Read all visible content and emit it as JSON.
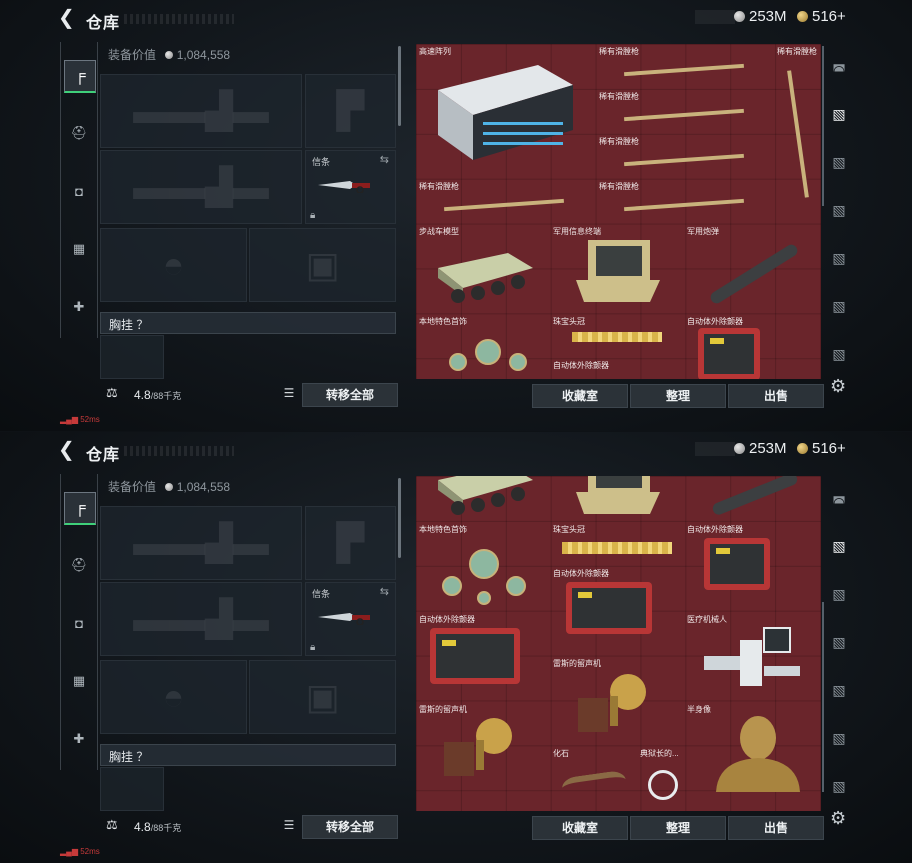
{
  "header": {
    "title": "仓库",
    "currency_1": "253M",
    "currency_2": "516+"
  },
  "equipment": {
    "value_label": "装备价值",
    "value": "1,084,558",
    "knife_label": "信条",
    "chest_label": "胸挂 ？"
  },
  "footer": {
    "weight": "4.8",
    "weight_unit": "/88千克",
    "transfer_all": "转移全部"
  },
  "actions": {
    "collection": "收藏室",
    "sort": "整理",
    "sell": "出售"
  },
  "status": {
    "signal": "52ms"
  },
  "panel_1_items": [
    {
      "name": "高速阵列"
    },
    {
      "name": "稀有滑膛枪"
    },
    {
      "name": "稀有滑膛枪"
    },
    {
      "name": "稀有滑膛枪"
    },
    {
      "name": "稀有滑膛枪"
    },
    {
      "name": "稀有滑膛枪"
    },
    {
      "name": "稀有滑膛枪"
    },
    {
      "name": "步战车模型"
    },
    {
      "name": "军用信息终端"
    },
    {
      "name": "军用炮弹"
    },
    {
      "name": "本地特色首饰"
    },
    {
      "name": "珠宝头冠"
    },
    {
      "name": "自动体外除颤器"
    },
    {
      "name": "自动体外除颤器"
    }
  ],
  "panel_2_items": [
    {
      "name": "本地特色首饰"
    },
    {
      "name": "珠宝头冠"
    },
    {
      "name": "自动体外除颤器"
    },
    {
      "name": "自动体外除颤器"
    },
    {
      "name": "自动体外除颤器"
    },
    {
      "name": "医疗机械人"
    },
    {
      "name": "雷斯的留声机"
    },
    {
      "name": "雷斯的留声机"
    },
    {
      "name": "半身像"
    },
    {
      "name": "化石"
    },
    {
      "name": "典狱长的..."
    }
  ],
  "colors": {
    "grid_bg": "#6a252b",
    "accent_green": "#3fd07a",
    "panel_bg": "#12171c"
  },
  "icons": {
    "back": "back-arrow-icon",
    "pistol": "pistol-icon",
    "gear": "gear-icon"
  }
}
